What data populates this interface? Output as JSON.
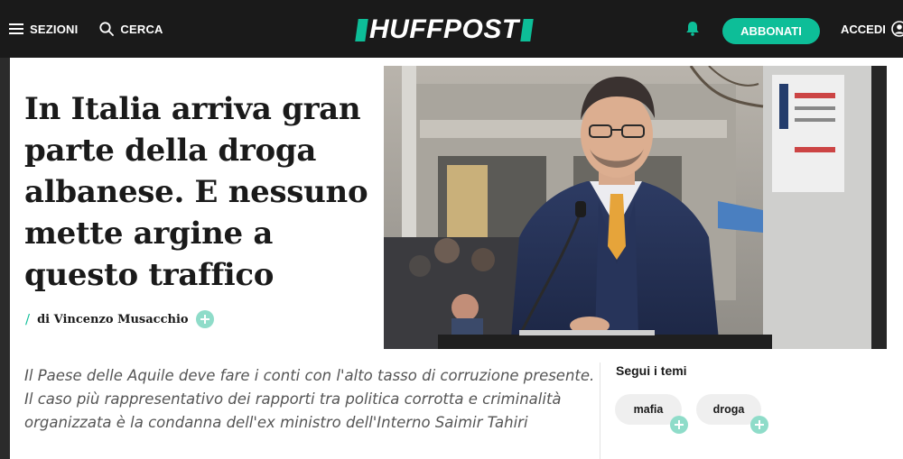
{
  "header": {
    "sections_label": "SEZIONI",
    "search_label": "CERCA",
    "logo_text": "HUFFPOST",
    "subscribe_label": "ABBONATI",
    "login_label": "ACCEDI"
  },
  "article": {
    "headline": "In Italia arriva gran parte della droga albanese. E nessuno mette argine a questo traffico",
    "byline_slash": "/",
    "author": "di Vincenzo Musacchio",
    "lede": "Il Paese delle Aquile deve fare i conti con l'alto tasso di corruzione presente. Il caso più rappresentativo dei rapporti tra politica corrotta e criminalità organizzata è la condanna dell'ex ministro dell'Interno Saimir Tahiri"
  },
  "topics": {
    "title": "Segui i temi",
    "tags": [
      {
        "label": "mafia"
      },
      {
        "label": "droga"
      }
    ]
  },
  "colors": {
    "brand_accent": "#0dbe98",
    "topbar_bg": "#1a1a1a",
    "follow_plus": "#8fdcc9"
  },
  "icons": [
    "menu-icon",
    "search-icon",
    "bell-icon",
    "user-icon",
    "plus-icon"
  ]
}
